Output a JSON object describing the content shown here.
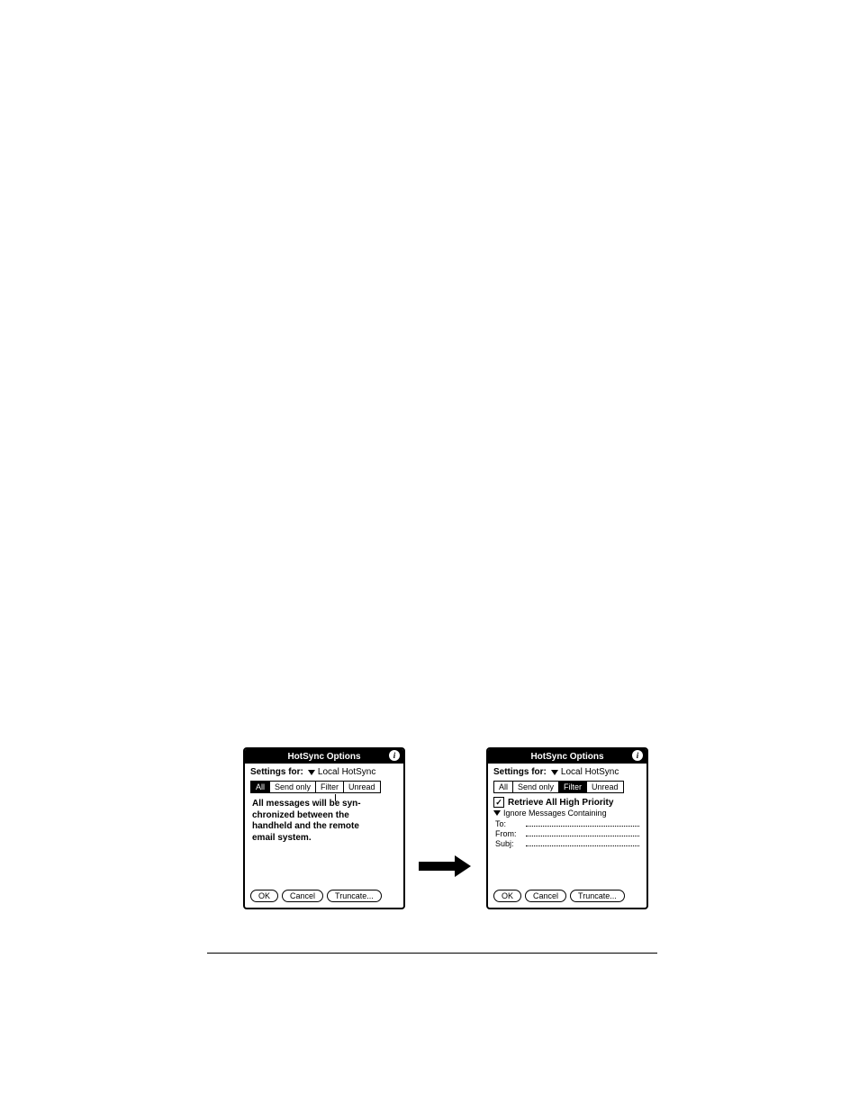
{
  "dialog": {
    "title": "HotSync Options",
    "info_glyph": "i",
    "settings_label": "Settings for:",
    "settings_value": "Local HotSync",
    "tabs": [
      "All",
      "Send only",
      "Filter",
      "Unread"
    ],
    "all_body": "All messages will be syn-\nchronized between the\nhandheld and the remote\nemail system.",
    "retrieve_label": "Retrieve All High Priority",
    "check_glyph": "✓",
    "ignore_label": "Ignore Messages Containing",
    "fields": {
      "to": "To:",
      "from": "From:",
      "subj": "Subj:"
    },
    "buttons": {
      "ok": "OK",
      "cancel": "Cancel",
      "truncate": "Truncate..."
    }
  }
}
